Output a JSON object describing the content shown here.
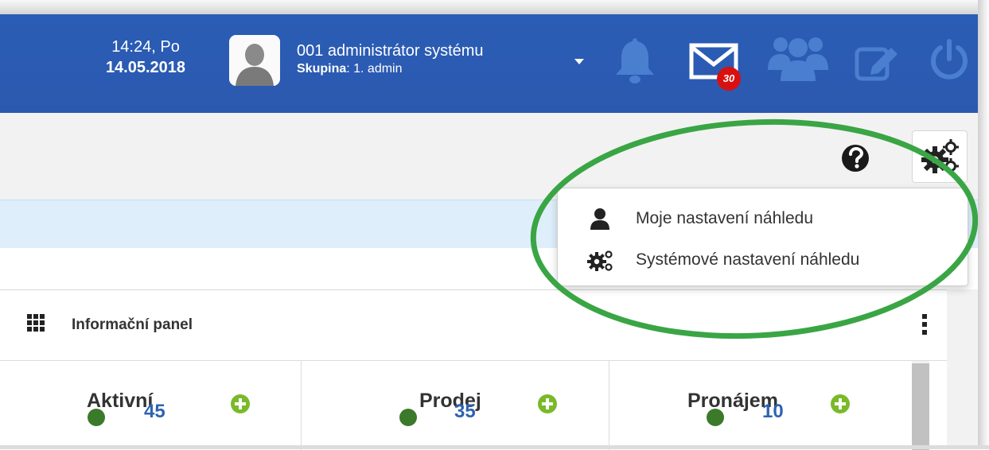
{
  "header": {
    "time": "14:24, Po",
    "date": "14.05.2018",
    "user_name": "001 administrátor systému",
    "group_label": "Skupina",
    "group_value": ": 1. admin",
    "mail_count": "30"
  },
  "toolbar": {
    "help_icon": "question-circle-icon",
    "settings_icon": "cogs-icon"
  },
  "dropdown": {
    "items": [
      {
        "label": "Moje nastavení náhledu",
        "icon": "user-icon"
      },
      {
        "label": "Systémové nastavení náhledu",
        "icon": "cogs-icon"
      }
    ]
  },
  "panel": {
    "title": "Informační panel",
    "cards": [
      {
        "title": "Aktivní",
        "value": "45"
      },
      {
        "title": "Prodej",
        "value": "35"
      },
      {
        "title": "Pronájem",
        "value": "10"
      }
    ]
  },
  "colors": {
    "header_bg": "#2c5bb2",
    "header_icon_muted": "#4a7fd0",
    "badge": "#d81010",
    "plus_green": "#7ab929",
    "status_dot": "#3a7a2a",
    "value_blue": "#2e63b2",
    "highlight_ellipse": "#3aa544"
  }
}
